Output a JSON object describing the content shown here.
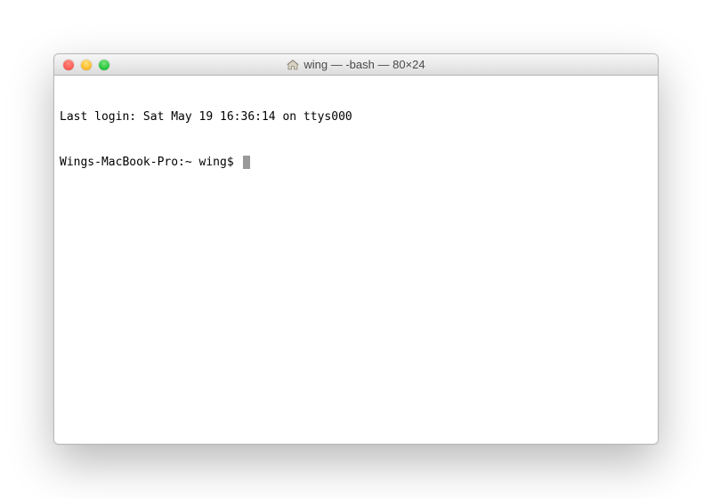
{
  "titlebar": {
    "title": "wing — -bash — 80×24"
  },
  "terminal": {
    "last_login": "Last login: Sat May 19 16:36:14 on ttys000",
    "prompt": "Wings-MacBook-Pro:~ wing$ "
  }
}
